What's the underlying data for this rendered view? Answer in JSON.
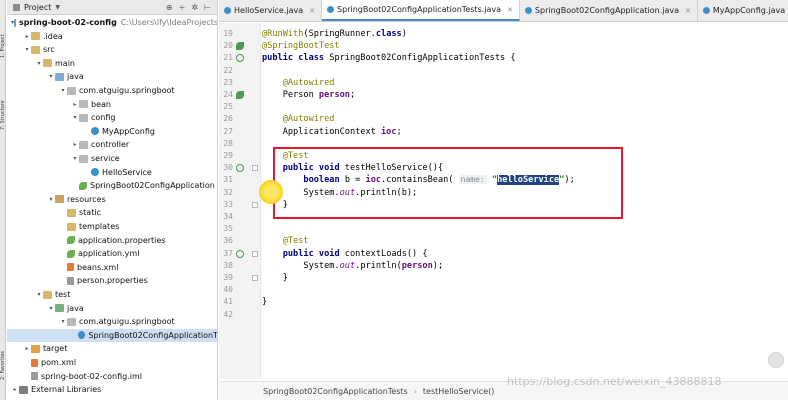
{
  "tool_strip": {
    "labels": [
      "1: Project",
      "7: Structure",
      "2: Favorites"
    ]
  },
  "project_panel": {
    "title": "Project",
    "tools": [
      "⊕",
      "÷",
      "✲",
      "⊢"
    ],
    "tree": [
      {
        "label": "spring-boot-02-config",
        "path": "C:\\Users\\lfy\\IdeaProjects",
        "depth": 0,
        "expanded": true,
        "icon": "folder-blue-icon",
        "bold": true
      },
      {
        "label": ".idea",
        "depth": 1,
        "expanded": false,
        "icon": "folder-icon"
      },
      {
        "label": "src",
        "depth": 1,
        "expanded": true,
        "icon": "folder-icon"
      },
      {
        "label": "main",
        "depth": 2,
        "expanded": true,
        "icon": "folder-icon"
      },
      {
        "label": "java",
        "depth": 3,
        "expanded": true,
        "icon": "folder-src-icon"
      },
      {
        "label": "com.atguigu.springboot",
        "depth": 4,
        "expanded": true,
        "icon": "package-icon"
      },
      {
        "label": "bean",
        "depth": 5,
        "expanded": false,
        "icon": "package-icon"
      },
      {
        "label": "config",
        "depth": 5,
        "expanded": true,
        "icon": "package-icon"
      },
      {
        "label": "MyAppConfig",
        "depth": 6,
        "icon": "class-icon"
      },
      {
        "label": "controller",
        "depth": 5,
        "expanded": false,
        "icon": "package-icon"
      },
      {
        "label": "service",
        "depth": 5,
        "expanded": true,
        "icon": "package-icon"
      },
      {
        "label": "HelloService",
        "depth": 6,
        "icon": "class-icon"
      },
      {
        "label": "SpringBoot02ConfigApplication",
        "depth": 5,
        "icon": "springboot-icon"
      },
      {
        "label": "resources",
        "depth": 3,
        "expanded": true,
        "icon": "folder-res-icon"
      },
      {
        "label": "static",
        "depth": 4,
        "icon": "folder-icon"
      },
      {
        "label": "templates",
        "depth": 4,
        "icon": "folder-icon"
      },
      {
        "label": "application.properties",
        "depth": 4,
        "icon": "springboot-icon"
      },
      {
        "label": "application.yml",
        "depth": 4,
        "icon": "springboot-icon"
      },
      {
        "label": "beans.xml",
        "depth": 4,
        "icon": "xml-icon"
      },
      {
        "label": "person.properties",
        "depth": 4,
        "icon": "properties-icon"
      },
      {
        "label": "test",
        "depth": 2,
        "expanded": true,
        "icon": "folder-icon"
      },
      {
        "label": "java",
        "depth": 3,
        "expanded": true,
        "icon": "folder-test-icon"
      },
      {
        "label": "com.atguigu.springboot",
        "depth": 4,
        "expanded": true,
        "icon": "package-icon"
      },
      {
        "label": "SpringBoot02ConfigApplicationT",
        "depth": 5,
        "icon": "class-icon",
        "selected": true
      },
      {
        "label": "target",
        "depth": 1,
        "expanded": false,
        "icon": "folder-orange-icon"
      },
      {
        "label": "pom.xml",
        "depth": 1,
        "icon": "maven-icon"
      },
      {
        "label": "spring-boot-02-config.iml",
        "depth": 1,
        "icon": "iml-icon"
      },
      {
        "label": "External Libraries",
        "depth": 0,
        "expanded": false,
        "icon": "library-icon"
      }
    ]
  },
  "tabs": [
    {
      "label": "HelloService.java",
      "active": false
    },
    {
      "label": "SpringBoot02ConfigApplicationTests.java",
      "active": true
    },
    {
      "label": "SpringBoot02ConfigApplication.java",
      "active": false
    },
    {
      "label": "MyAppConfig.java",
      "active": false
    }
  ],
  "editor": {
    "lines": [
      {
        "n": "19",
        "segs": [
          [
            "ann",
            "@RunWith"
          ],
          [
            "",
            "(SpringRunner."
          ],
          [
            "kw",
            "class"
          ],
          [
            "",
            ")"
          ]
        ]
      },
      {
        "n": "20",
        "mark": "bean",
        "segs": [
          [
            "ann",
            "@SpringBootTest"
          ]
        ]
      },
      {
        "n": "21",
        "mark": "run",
        "segs": [
          [
            "kw",
            "public class "
          ],
          [
            "",
            "SpringBoot02ConfigApplicationTests {"
          ]
        ]
      },
      {
        "n": "22",
        "segs": []
      },
      {
        "n": "23",
        "segs": [
          [
            "",
            "    "
          ],
          [
            "ann",
            "@Autowired"
          ]
        ]
      },
      {
        "n": "24",
        "mark": "bean",
        "segs": [
          [
            "",
            "    Person "
          ],
          [
            "fld",
            "person"
          ],
          [
            "",
            ";"
          ]
        ]
      },
      {
        "n": "25",
        "segs": []
      },
      {
        "n": "26",
        "segs": [
          [
            "",
            "    "
          ],
          [
            "ann",
            "@Autowired"
          ]
        ]
      },
      {
        "n": "27",
        "segs": [
          [
            "",
            "    ApplicationContext "
          ],
          [
            "fld",
            "ioc"
          ],
          [
            "",
            ";"
          ]
        ]
      },
      {
        "n": "28",
        "segs": []
      },
      {
        "n": "29",
        "segs": [
          [
            "",
            "    "
          ],
          [
            "ann",
            "@Test"
          ]
        ]
      },
      {
        "n": "30",
        "mark": "run",
        "fold": true,
        "segs": [
          [
            "",
            "    "
          ],
          [
            "kw",
            "public void "
          ],
          [
            "",
            "testHelloService(){"
          ]
        ]
      },
      {
        "n": "31",
        "segs": [
          [
            "",
            "        "
          ],
          [
            "kw",
            "boolean "
          ],
          [
            "",
            "b = "
          ],
          [
            "fld",
            "ioc"
          ],
          [
            "",
            ".containsBean( "
          ],
          [
            "hint",
            "name:"
          ],
          [
            "str-pre",
            " \""
          ],
          [
            "str-sel",
            "helloService"
          ],
          [
            "str-post",
            "\""
          ],
          [
            "",
            ");"
          ]
        ]
      },
      {
        "n": "32",
        "segs": [
          [
            "",
            "        System."
          ],
          [
            "it",
            "out"
          ],
          [
            "",
            ".println(b);"
          ]
        ]
      },
      {
        "n": "33",
        "fold": true,
        "segs": [
          [
            "",
            "    }"
          ]
        ]
      },
      {
        "n": "34",
        "segs": []
      },
      {
        "n": "35",
        "segs": []
      },
      {
        "n": "36",
        "segs": [
          [
            "",
            "    "
          ],
          [
            "ann",
            "@Test"
          ]
        ]
      },
      {
        "n": "37",
        "mark": "run",
        "fold": true,
        "segs": [
          [
            "",
            "    "
          ],
          [
            "kw",
            "public void "
          ],
          [
            "",
            "contextLoads() {"
          ]
        ]
      },
      {
        "n": "38",
        "segs": [
          [
            "",
            "        System."
          ],
          [
            "it",
            "out"
          ],
          [
            "",
            ".println("
          ],
          [
            "fld",
            "person"
          ],
          [
            "",
            ");"
          ]
        ]
      },
      {
        "n": "39",
        "fold": true,
        "segs": [
          [
            "",
            "    }"
          ]
        ]
      },
      {
        "n": "40",
        "segs": []
      },
      {
        "n": "41",
        "segs": [
          [
            "",
            "}"
          ]
        ]
      },
      {
        "n": "42",
        "segs": []
      }
    ]
  },
  "breadcrumb": [
    "SpringBoot02ConfigApplicationTests",
    "testHelloService()"
  ],
  "watermark": "https://blog.csdn.net/weixin_43888818"
}
